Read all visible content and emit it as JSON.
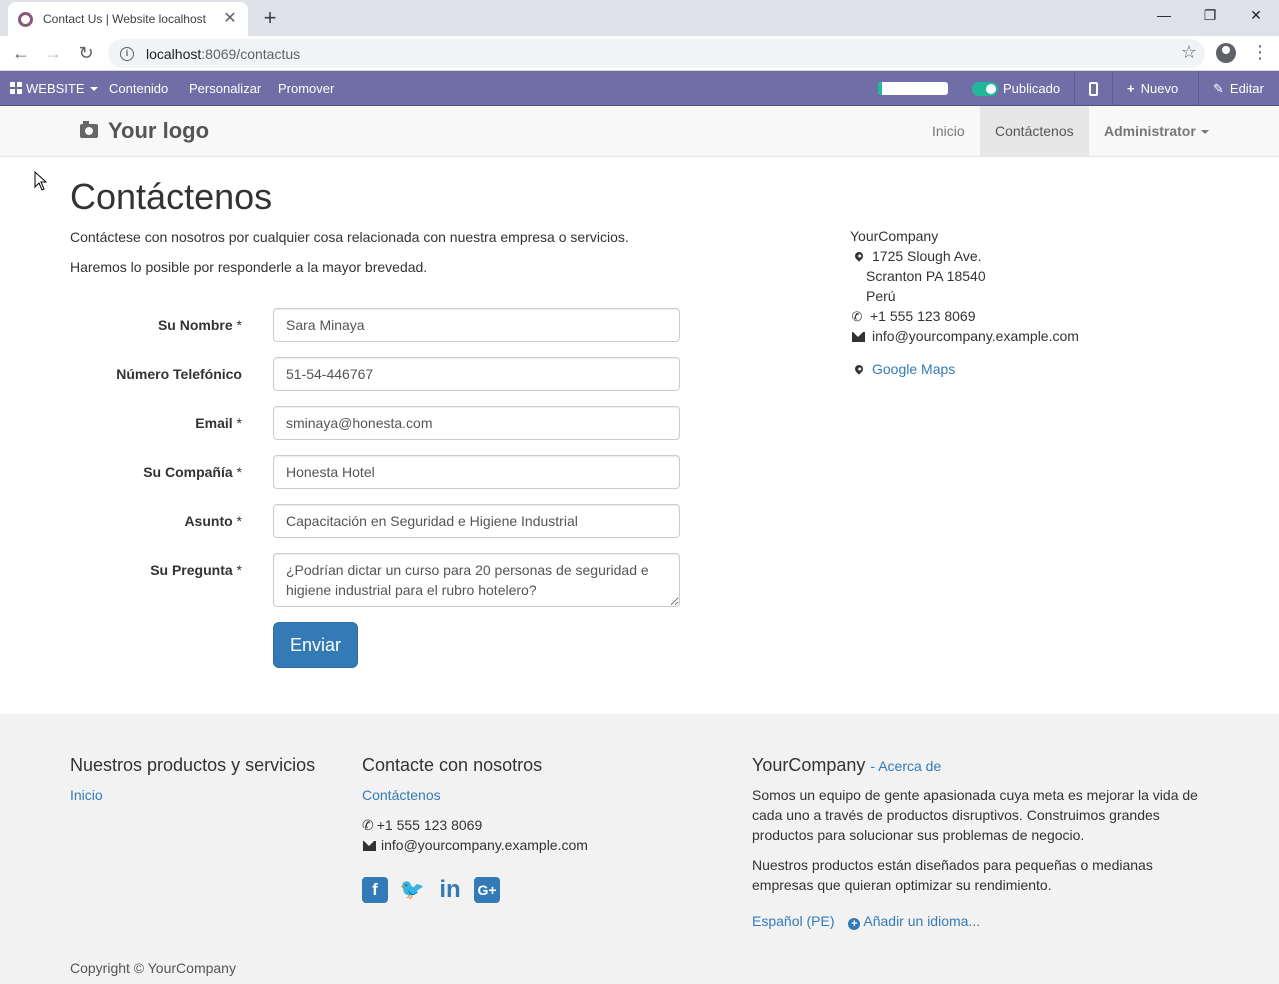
{
  "browser": {
    "tab_title": "Contact Us | Website localhost",
    "new_tab": "+",
    "tab_close": "✕",
    "url_host": "localhost",
    "url_rest": ":8069/contactus",
    "win_min": "—",
    "win_restore": "❐",
    "win_close": "✕",
    "back": "←",
    "forward": "→",
    "reload": "↻",
    "star": "☆",
    "menu": "⋮"
  },
  "adminbar": {
    "apps_label": "WEBSITE",
    "content": "Contenido",
    "customize": "Personalizar",
    "promote": "Promover",
    "seo_progress": 0.05,
    "published_label": "Publicado",
    "new_label": "Nuevo",
    "edit_label": "Editar",
    "colors": {
      "bar": "#6f6ea6",
      "accent": "#21b799"
    }
  },
  "header": {
    "logo_text": "Your logo",
    "nav": {
      "home": "Inicio",
      "contact": "Contáctenos",
      "user": "Administrator"
    }
  },
  "main": {
    "title": "Contáctenos",
    "intro_1": "Contáctese con nosotros por cualquier cosa relacionada con nuestra empresa o servicios.",
    "intro_2": "Haremos lo posible por responderle a la mayor brevedad.",
    "form": {
      "name_label": "Su Nombre",
      "name_value": "Sara Minaya",
      "phone_label": "Número Telefónico",
      "phone_value": "51-54-446767",
      "email_label": "Email",
      "email_value": "sminaya@honesta.com",
      "company_label": "Su Compañía",
      "company_value": "Honesta Hotel",
      "subject_label": "Asunto",
      "subject_value": "Capacitación en Seguridad e Higiene Industrial",
      "question_label": "Su Pregunta",
      "question_value": "¿Podrían dictar un curso para 20 personas de seguridad e higiene industrial para el rubro hotelero?",
      "required_mark": "*",
      "submit_label": "Enviar"
    },
    "address": {
      "company": "YourCompany",
      "street": "1725 Slough Ave.",
      "city": "Scranton PA 18540",
      "country": "Perú",
      "phone": "+1 555 123 8069",
      "email": "info@yourcompany.example.com",
      "maps_label": "Google Maps"
    }
  },
  "footer": {
    "col1_title": "Nuestros productos y servicios",
    "col1_link": "Inicio",
    "col2_title": "Contacte con nosotros",
    "col2_link": "Contáctenos",
    "phone": "+1 555 123 8069",
    "email": "info@yourcompany.example.com",
    "social": {
      "facebook": "f",
      "twitter": "🐦",
      "linkedin": "in",
      "google": "G+"
    },
    "col3_title": "YourCompany",
    "col3_about": "- Acerca de",
    "col3_p1": "Somos un equipo de gente apasionada cuya meta es mejorar la vida de cada uno a través de productos disruptivos. Construimos grandes productos para solucionar sus problemas de negocio.",
    "col3_p2": "Nuestros productos están diseñados para pequeñas o medianas empresas que quieran optimizar su rendimiento.",
    "language": "Español (PE)",
    "add_language": "Añadir un idioma...",
    "copyright": "Copyright © YourCompany"
  }
}
